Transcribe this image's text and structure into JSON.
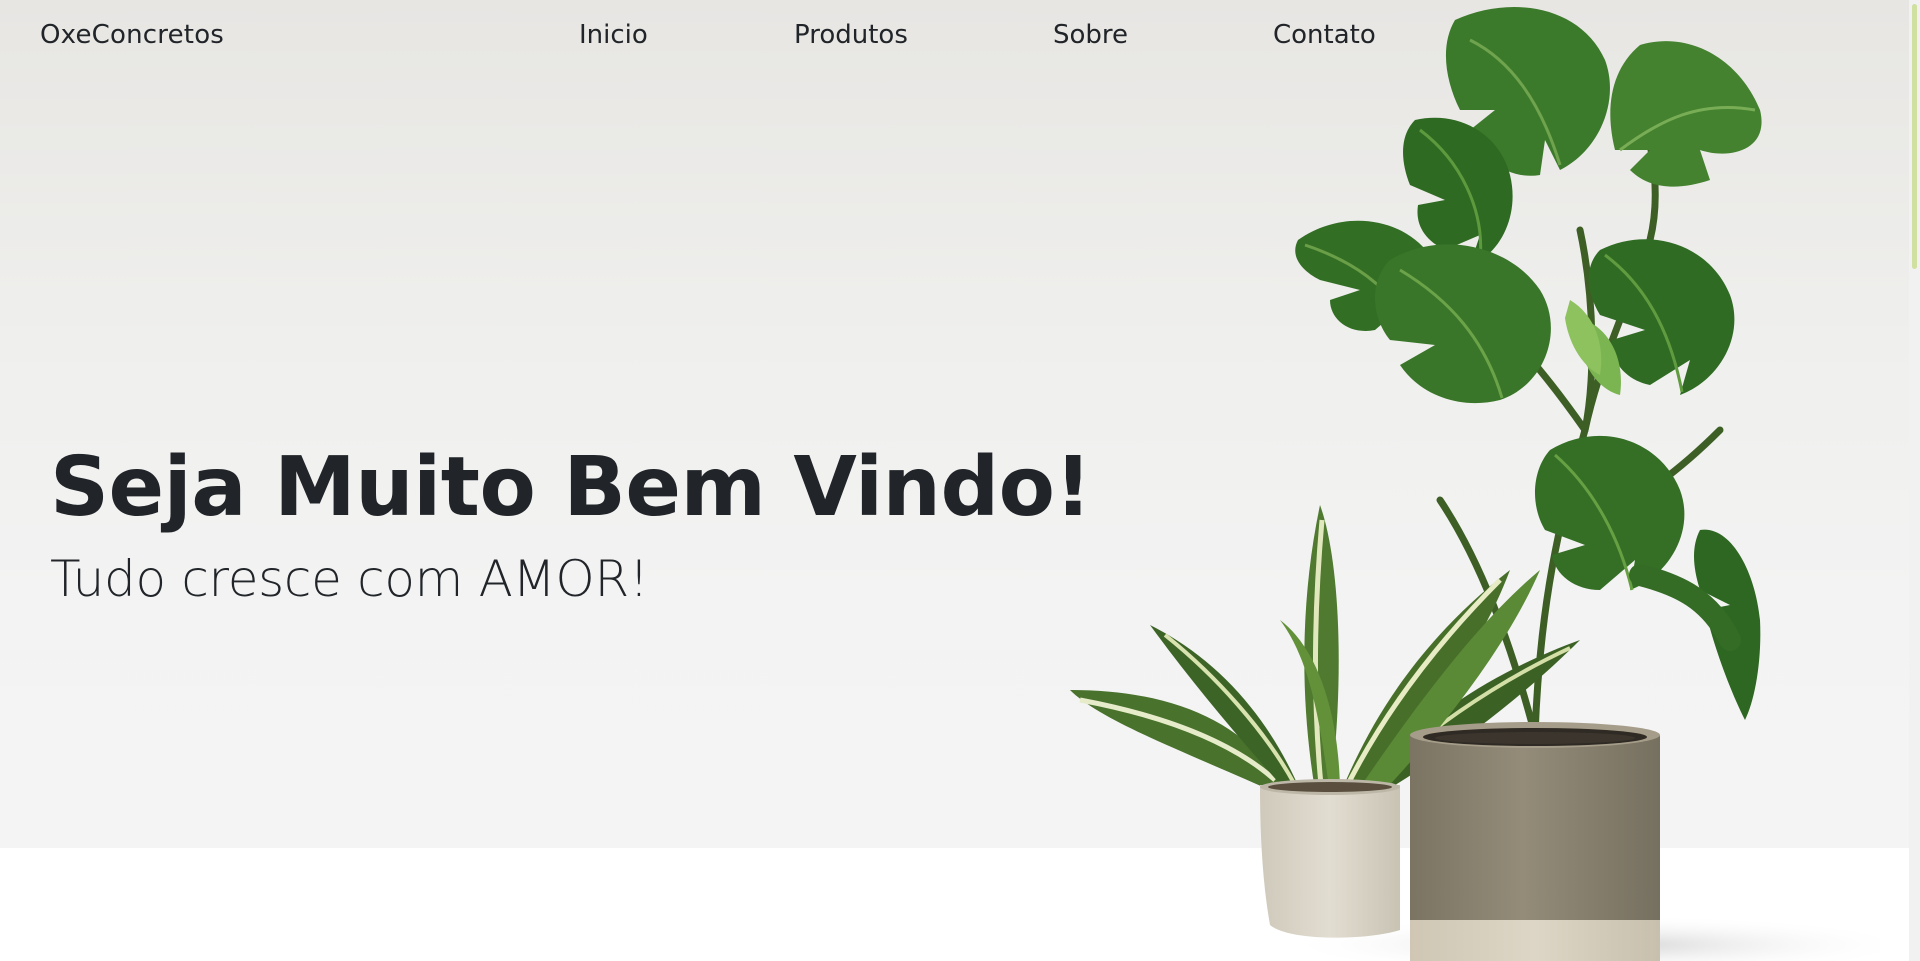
{
  "brand": "OxeConcretos",
  "nav": {
    "items": [
      {
        "label": "Inicio"
      },
      {
        "label": "Produtos"
      },
      {
        "label": "Sobre"
      },
      {
        "label": "Contato"
      }
    ]
  },
  "hero": {
    "title": "Seja Muito Bem Vindo!",
    "subtitle": "Tudo cresce com AMOR!"
  },
  "colors": {
    "text": "#212529",
    "hero_bg_top": "#e7e6e3",
    "hero_bg_bottom": "#f4f4f4",
    "leaf_dark": "#2f5a22",
    "leaf_mid": "#3e7a2c",
    "pot_taupe": "#8a8270",
    "pot_cream": "#d9d4c6"
  },
  "icons": {
    "plant_image": "plant-illustration"
  }
}
